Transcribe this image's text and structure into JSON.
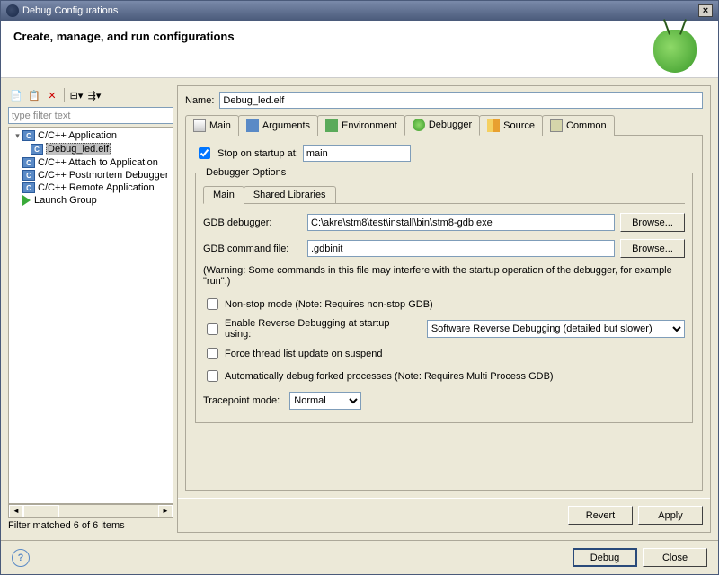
{
  "window": {
    "title": "Debug Configurations"
  },
  "header": {
    "title": "Create, manage, and run configurations"
  },
  "left": {
    "filter_placeholder": "type filter text",
    "tree": [
      {
        "label": "C/C++ Application",
        "expanded": true,
        "children": [
          {
            "label": "Debug_led.elf",
            "selected": true
          }
        ]
      },
      {
        "label": "C/C++ Attach to Application"
      },
      {
        "label": "C/C++ Postmortem Debugger"
      },
      {
        "label": "C/C++ Remote Application"
      },
      {
        "label": "Launch Group",
        "icon": "launch"
      }
    ],
    "status": "Filter matched 6 of 6 items"
  },
  "config": {
    "name_label": "Name:",
    "name_value": "Debug_led.elf",
    "tabs": [
      "Main",
      "Arguments",
      "Environment",
      "Debugger",
      "Source",
      "Common"
    ],
    "active_tab": "Debugger",
    "debugger": {
      "stop_label": "Stop on startup at:",
      "stop_value": "main",
      "stop_checked": true,
      "options_legend": "Debugger Options",
      "inner_tabs": [
        "Main",
        "Shared Libraries"
      ],
      "gdb_label": "GDB debugger:",
      "gdb_value": "C:\\akre\\stm8\\test\\install\\bin\\stm8-gdb.exe",
      "cmdfile_label": "GDB command file:",
      "cmdfile_value": ".gdbinit",
      "browse": "Browse...",
      "warning": "(Warning: Some commands in this file may interfere with the startup operation of the debugger, for example \"run\".)",
      "nonstop_label": "Non-stop mode (Note: Requires non-stop GDB)",
      "reverse_label": "Enable Reverse Debugging at startup using:",
      "reverse_options": [
        "Software Reverse Debugging (detailed but slower)"
      ],
      "force_label": "Force thread list update on suspend",
      "autodbg_label": "Automatically debug forked processes (Note: Requires Multi Process GDB)",
      "trace_label": "Tracepoint mode:",
      "trace_options": [
        "Normal"
      ]
    },
    "buttons": {
      "revert": "Revert",
      "apply": "Apply"
    }
  },
  "footer": {
    "debug": "Debug",
    "close": "Close"
  }
}
